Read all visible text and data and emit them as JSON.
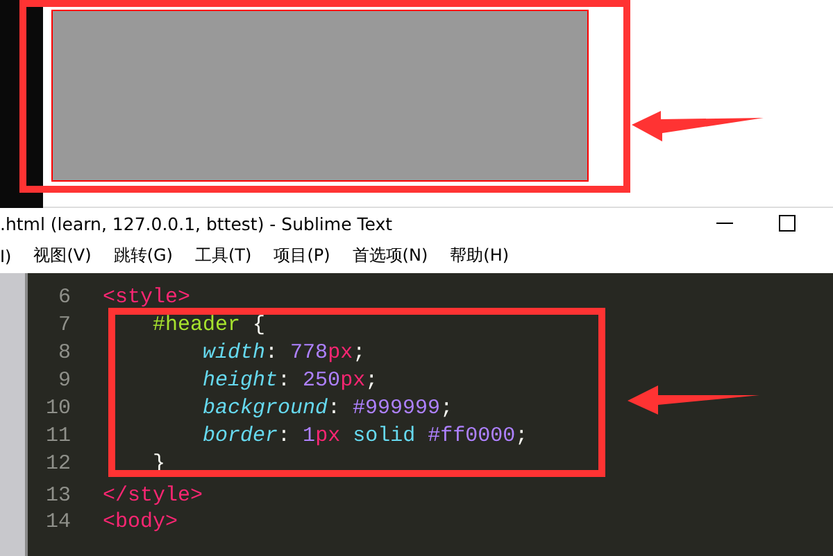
{
  "window": {
    "title": ".html (learn, 127.0.0.1, bttest) - Sublime Text"
  },
  "menu": [
    "I)",
    "视图(V)",
    "跳转(G)",
    "工具(T)",
    "项目(P)",
    "首选项(N)",
    "帮助(H)"
  ],
  "editor": {
    "lines": [
      {
        "number": "6",
        "kind": "tag",
        "tokens": [
          {
            "kind": "tag",
            "text": "<style>"
          }
        ]
      },
      {
        "number": "7",
        "kind": "rule",
        "tokens": [
          {
            "kind": "selector",
            "text": "#header"
          },
          {
            "kind": "brace",
            "text": "{"
          }
        ]
      },
      {
        "number": "8",
        "kind": "declaration",
        "tokens": [
          {
            "kind": "property",
            "text": "width"
          },
          {
            "kind": "plain",
            "text": ":"
          },
          {
            "kind": "number",
            "text": "778"
          },
          {
            "kind": "unit",
            "text": "px"
          },
          {
            "kind": "plain",
            "text": ";"
          }
        ]
      },
      {
        "number": "9",
        "kind": "declaration",
        "tokens": [
          {
            "kind": "property",
            "text": "height"
          },
          {
            "kind": "plain",
            "text": ":"
          },
          {
            "kind": "number",
            "text": "250"
          },
          {
            "kind": "unit",
            "text": "px"
          },
          {
            "kind": "plain",
            "text": ";"
          }
        ]
      },
      {
        "number": "10",
        "kind": "declaration",
        "tokens": [
          {
            "kind": "property",
            "text": "background"
          },
          {
            "kind": "plain",
            "text": ":"
          },
          {
            "kind": "hex",
            "text": "#999999"
          },
          {
            "kind": "plain",
            "text": ";"
          }
        ]
      },
      {
        "number": "11",
        "kind": "declaration",
        "tokens": [
          {
            "kind": "property",
            "text": "border"
          },
          {
            "kind": "plain",
            "text": ":"
          },
          {
            "kind": "number",
            "text": "1"
          },
          {
            "kind": "unit",
            "text": "px"
          },
          {
            "kind": "keyword",
            "text": "solid"
          },
          {
            "kind": "hex",
            "text": "#ff0000"
          },
          {
            "kind": "plain",
            "text": ";"
          }
        ]
      },
      {
        "number": "12",
        "kind": "rule",
        "tokens": [
          {
            "kind": "plain",
            "text": "}"
          }
        ]
      },
      {
        "number": "13",
        "kind": "tag",
        "tokens": [
          {
            "kind": "tag",
            "text": "</style>"
          }
        ]
      },
      {
        "number": "14",
        "kind": "tag",
        "tokens": [
          {
            "kind": "tag",
            "text": "<body>"
          }
        ]
      }
    ]
  }
}
